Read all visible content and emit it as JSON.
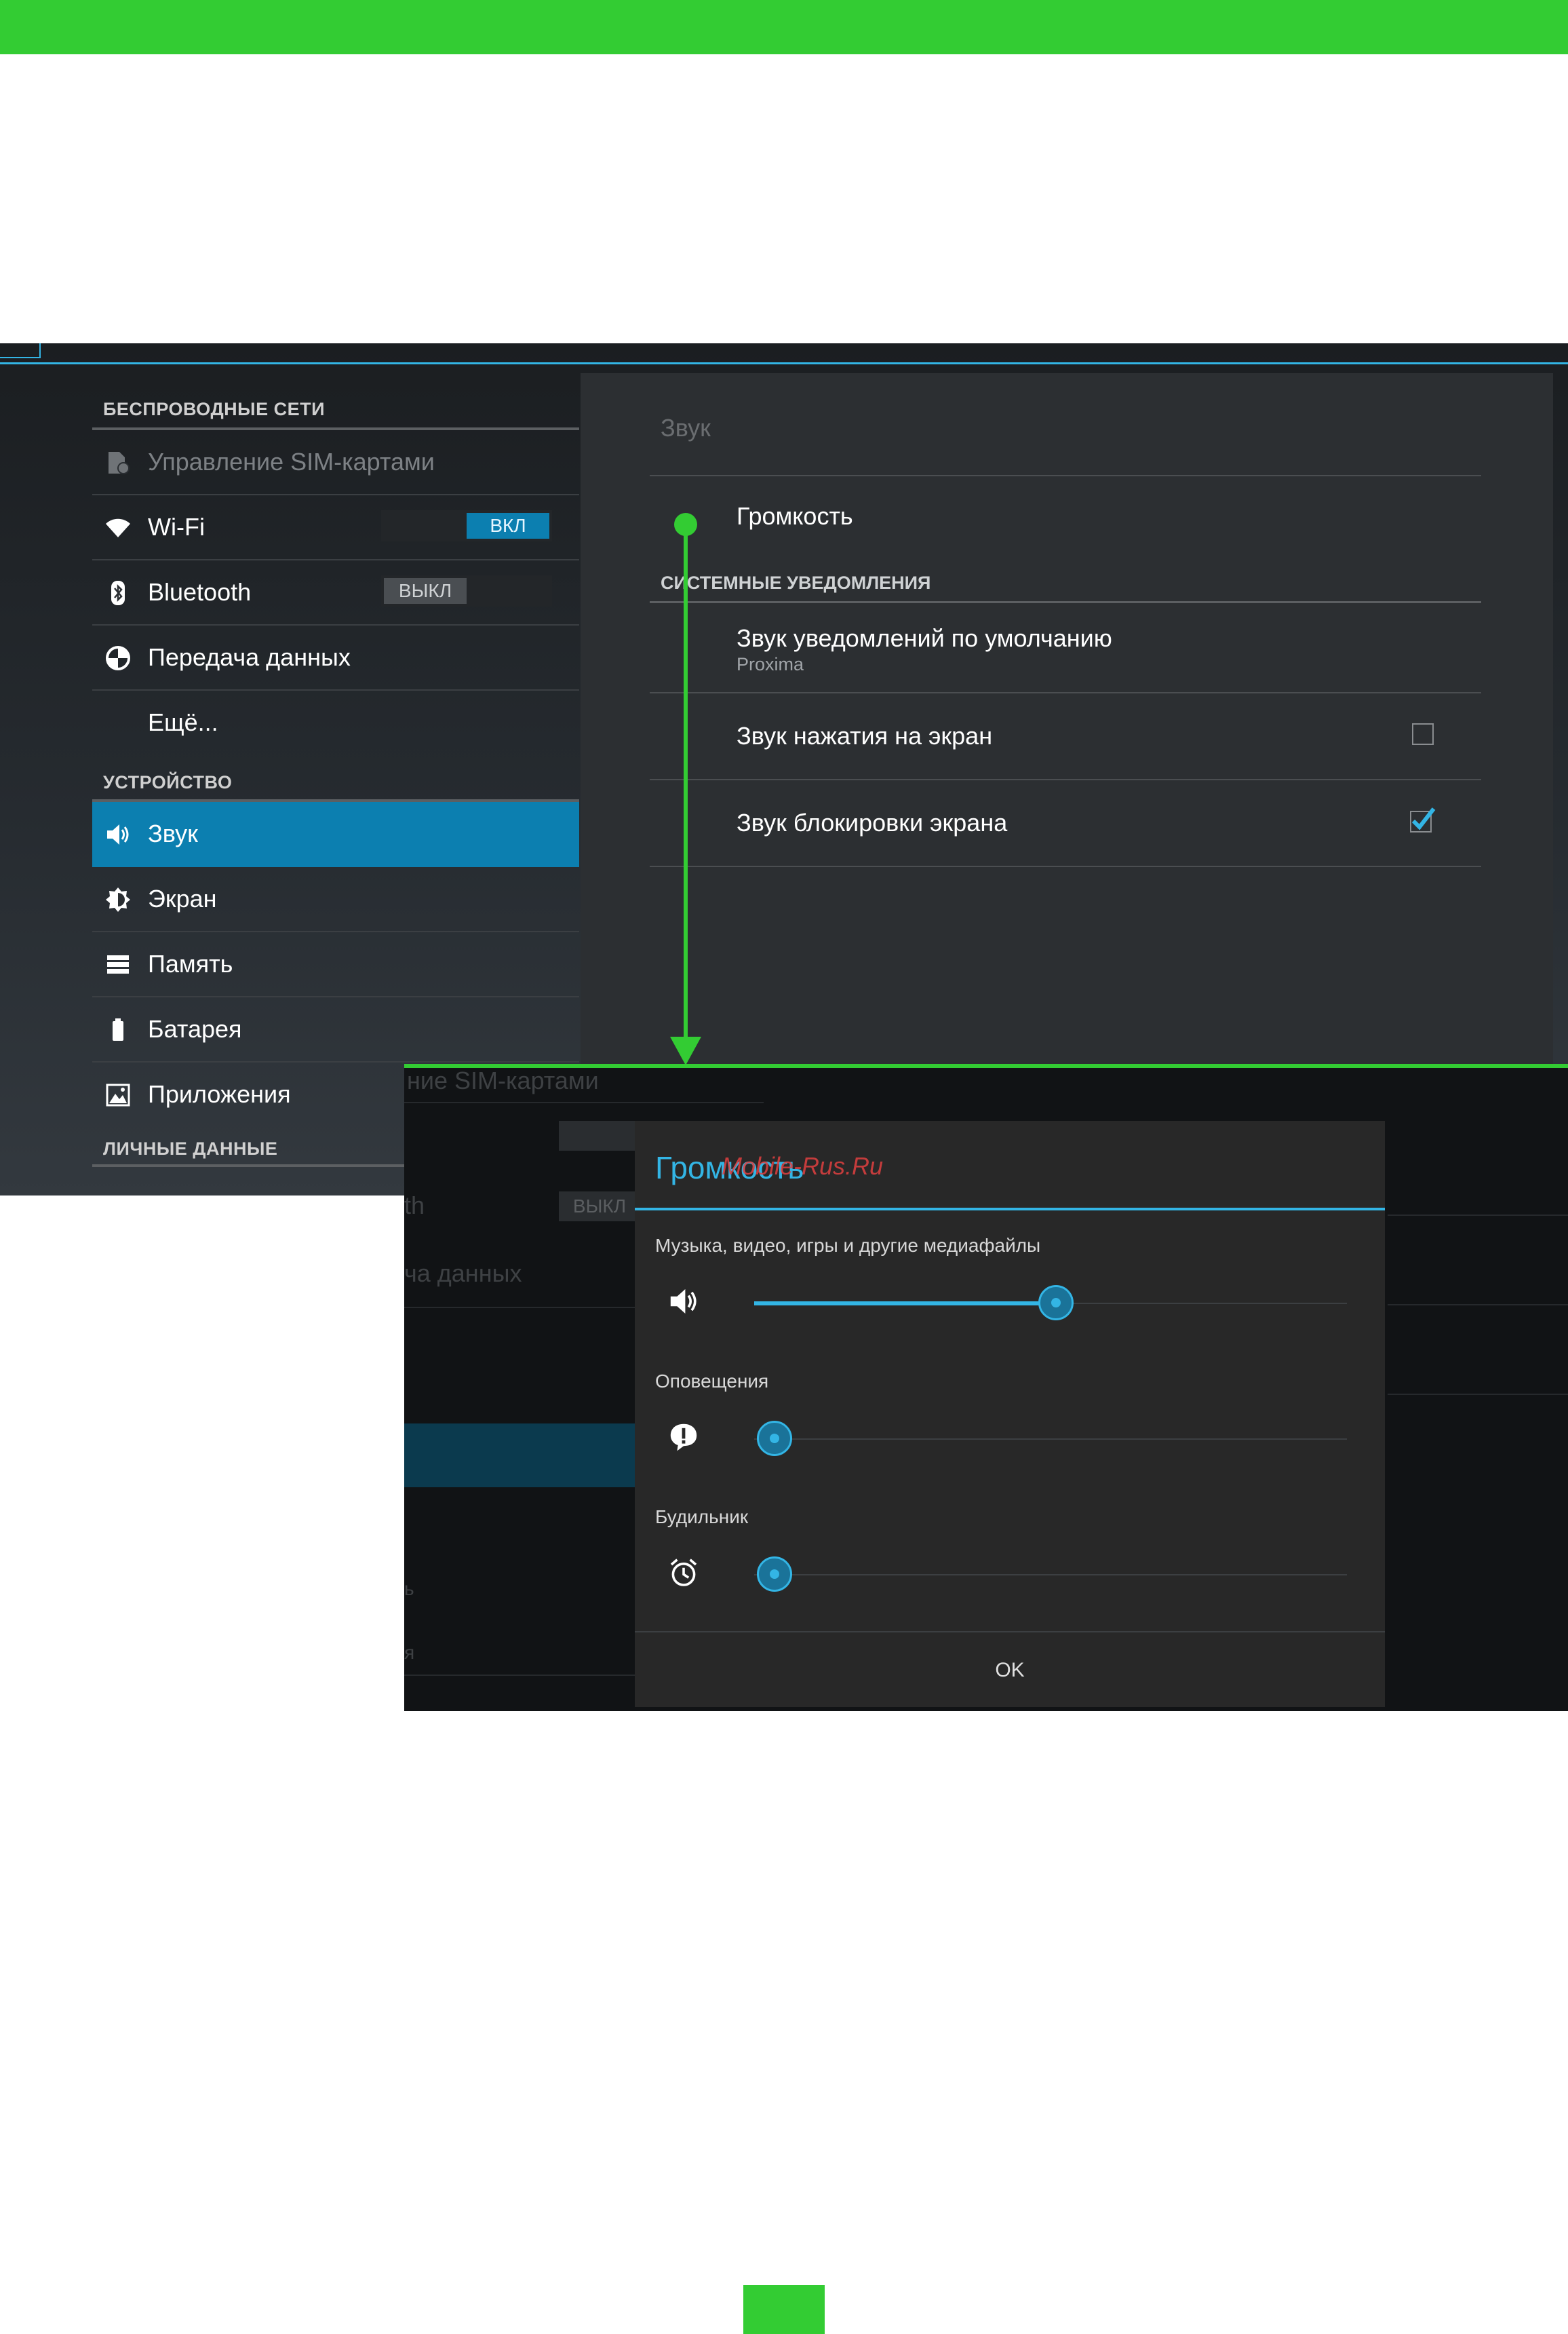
{
  "colors": {
    "accent_green": "#33cc33",
    "holo_blue": "#33b5e5",
    "selected_blue": "#0c7fb0"
  },
  "settings": {
    "sections": {
      "wireless": "БЕСПРОВОДНЫЕ СЕТИ",
      "device": "УСТРОЙСТВО",
      "personal": "ЛИЧНЫЕ ДАННЫЕ"
    },
    "items": {
      "sim": "Управление SIM-картами",
      "wifi": "Wi-Fi",
      "wifi_toggle": "ВКЛ",
      "bluetooth": "Bluetooth",
      "bluetooth_toggle": "ВЫКЛ",
      "data": "Передача данных",
      "more": "Ещё...",
      "sound": "Звук",
      "screen": "Экран",
      "memory": "Память",
      "battery": "Батарея",
      "apps": "Приложения"
    }
  },
  "sound_panel": {
    "title": "Звук",
    "volume": "Громкость",
    "system_section": "СИСТЕМНЫЕ УВЕДОМЛЕНИЯ",
    "default_sound": "Звук уведомлений по умолчанию",
    "default_sound_value": "Proxima",
    "touch_sound": "Звук нажатия на экран",
    "touch_sound_checked": false,
    "lock_sound": "Звук блокировки экрана",
    "lock_sound_checked": true
  },
  "background_fragments": {
    "sim": "ние SIM-картами",
    "bluetooth": "th",
    "bluetooth_toggle": "ВЫКЛ",
    "data": "ча данных",
    "memory": "ь",
    "battery": "я"
  },
  "volume_dialog": {
    "title": "Громкость",
    "watermark": "Mobile-Rus.Ru",
    "ok": "OK",
    "sliders": [
      {
        "label": "Музыка, видео, игры и другие медиафайлы",
        "icon": "speaker-icon",
        "level": 0.5
      },
      {
        "label": "Оповещения",
        "icon": "notification-bubble-icon",
        "level": 0.0
      },
      {
        "label": "Будильник",
        "icon": "alarm-clock-icon",
        "level": 0.0
      }
    ]
  }
}
